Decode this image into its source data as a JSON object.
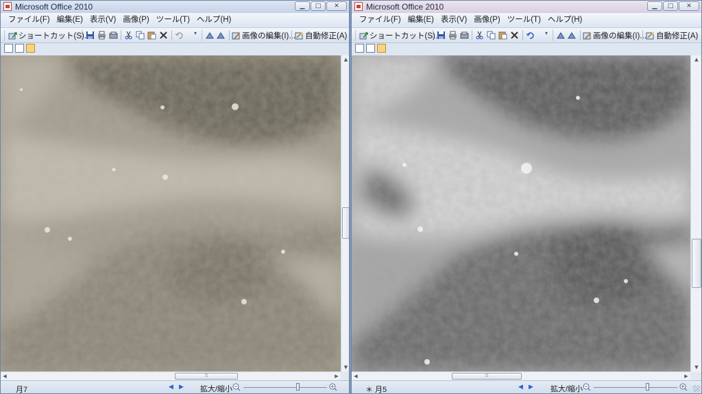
{
  "windows": [
    {
      "title": "Microsoft Office 2010",
      "window_buttons": {
        "minimize": "▁",
        "maximize": "□",
        "close": "✕"
      },
      "menu": [
        "ファイル(F)",
        "編集(E)",
        "表示(V)",
        "画像(P)",
        "ツール(T)",
        "ヘルプ(H)"
      ],
      "toolbar": {
        "shortcut": "ショートカット(S)...",
        "edit_image": "画像の編集(I)...",
        "auto_correct": "自動修正(A)"
      },
      "status": {
        "image_name": "月7",
        "zoom_label": "拡大/縮小",
        "zoom_level": 0.55
      },
      "accent": "#a39d8f",
      "vscroll_position": 0.48,
      "hscroll_position": 0.58
    },
    {
      "title": "Microsoft Office 2010",
      "window_buttons": {
        "minimize": "▁",
        "maximize": "□",
        "close": "✕"
      },
      "menu": [
        "ファイル(F)",
        "編集(E)",
        "表示(V)",
        "画像(P)",
        "ツール(T)",
        "ヘルプ(H)"
      ],
      "toolbar": {
        "shortcut": "ショートカット(S)...",
        "edit_image": "画像の編集(I)...",
        "auto_correct": "自動修正(A)"
      },
      "status": {
        "image_name": "＊ 月5",
        "zoom_label": "拡大/縮小",
        "zoom_level": 0.6
      },
      "accent": "#9d9d9d",
      "vscroll_position": 0.62,
      "hscroll_position": 0.58
    }
  ]
}
